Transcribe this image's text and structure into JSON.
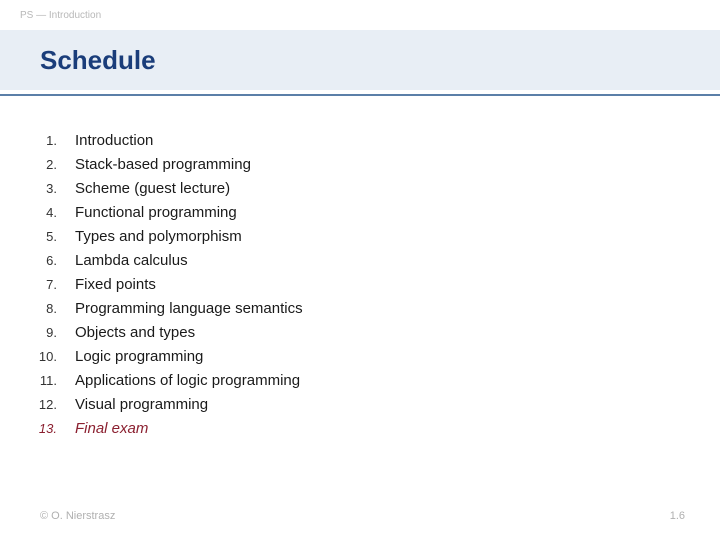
{
  "header": {
    "context": "PS — Introduction"
  },
  "title": "Schedule",
  "items": [
    {
      "n": "1.",
      "text": "Introduction",
      "emph": false
    },
    {
      "n": "2.",
      "text": "Stack-based programming",
      "emph": false
    },
    {
      "n": "3.",
      "text": "Scheme (guest lecture)",
      "emph": false
    },
    {
      "n": "4.",
      "text": "Functional programming",
      "emph": false
    },
    {
      "n": "5.",
      "text": "Types and polymorphism",
      "emph": false
    },
    {
      "n": "6.",
      "text": "Lambda calculus",
      "emph": false
    },
    {
      "n": "7.",
      "text": "Fixed points",
      "emph": false
    },
    {
      "n": "8.",
      "text": "Programming language semantics",
      "emph": false
    },
    {
      "n": "9.",
      "text": "Objects and types",
      "emph": false
    },
    {
      "n": "10.",
      "text": "Logic programming",
      "emph": false
    },
    {
      "n": "11.",
      "text": "Applications of logic programming",
      "emph": false
    },
    {
      "n": "12.",
      "text": "Visual programming",
      "emph": false
    },
    {
      "n": "13.",
      "text": "Final exam",
      "emph": true
    }
  ],
  "footer": {
    "copyright": "© O. Nierstrasz",
    "page": "1.6"
  }
}
